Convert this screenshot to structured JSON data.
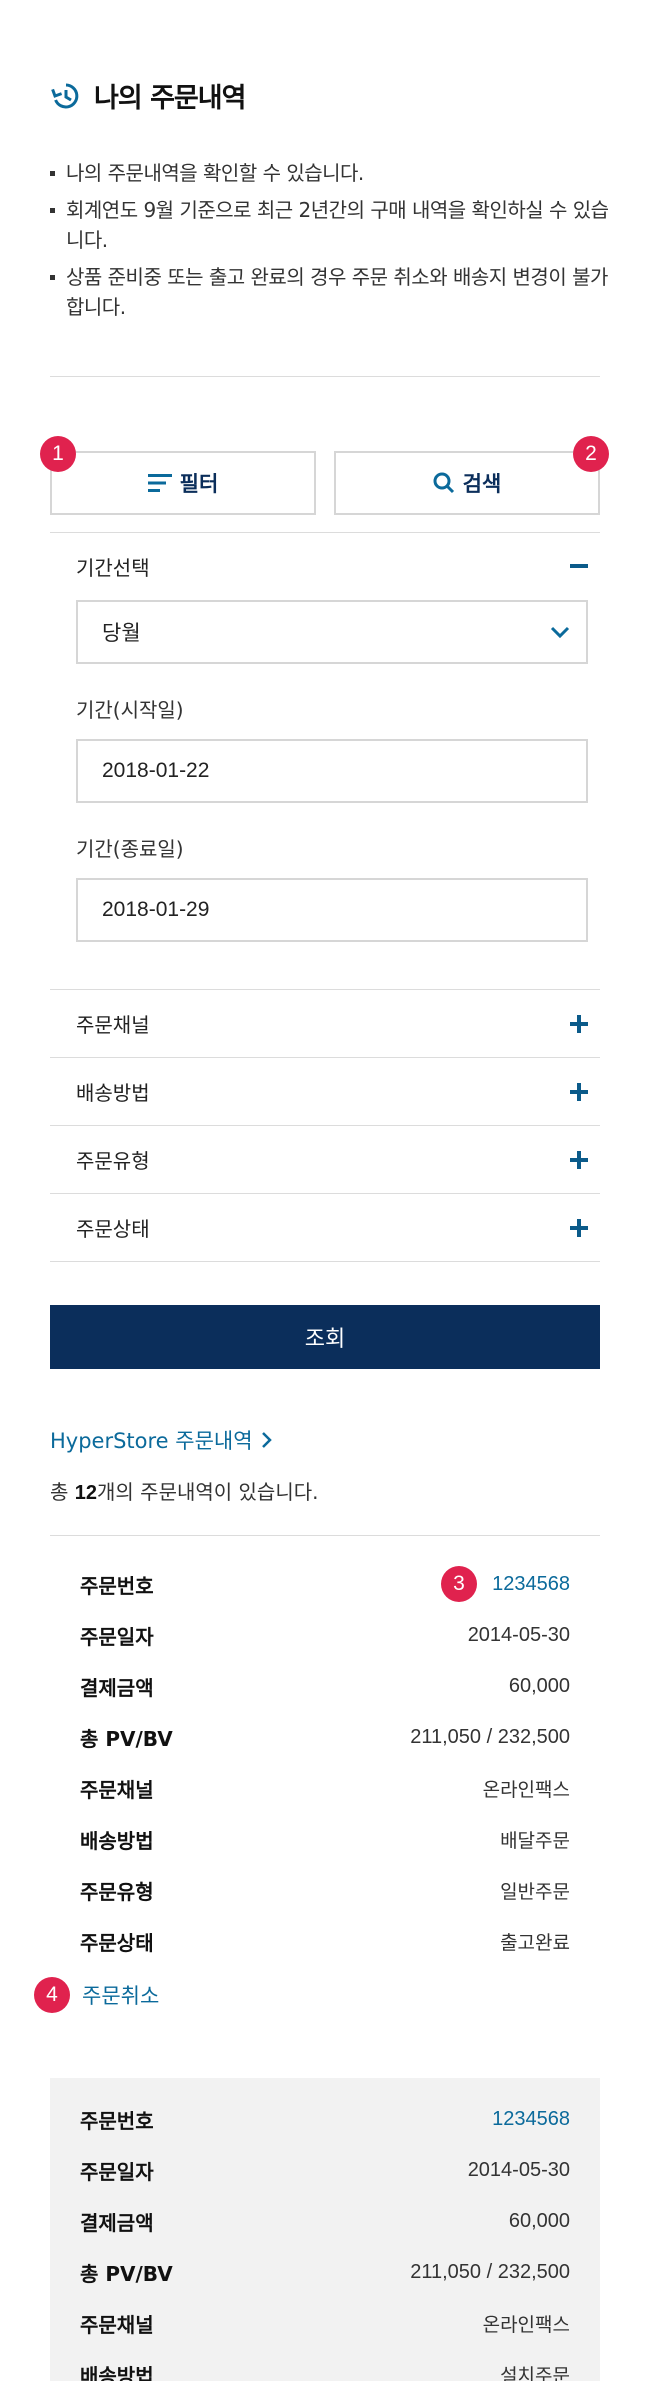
{
  "header": {
    "title": "나의 주문내역",
    "icon": "history-icon"
  },
  "notes": [
    "나의 주문내역을 확인할 수 있습니다.",
    "회계연도 9월 기준으로 최근 2년간의 구매 내역을 확인하실 수 있습니다.",
    "상품 준비중 또는 출고 완료의 경우 주문 취소와 배송지 변경이 불가합니다."
  ],
  "toolbar": {
    "filter_label": "필터",
    "search_label": "검색"
  },
  "badges": {
    "b1": "1",
    "b2": "2",
    "b3": "3",
    "b4": "4"
  },
  "filter": {
    "period_title": "기간선택",
    "period_value": "당월",
    "start_label": "기간(시작일)",
    "start_value": "2018-01-22",
    "end_label": "기간(종료일)",
    "end_value": "2018-01-29",
    "sections": [
      "주문채널",
      "배송방법",
      "주문유형",
      "주문상태"
    ]
  },
  "submit_label": "조회",
  "store": {
    "link_label": "HyperStore 주문내역",
    "total_prefix": "총 ",
    "total_count": "12",
    "total_suffix": "개의 주문내역이 있습니다."
  },
  "orders": [
    {
      "rows": [
        {
          "k": "주문번호",
          "v": "1234568"
        },
        {
          "k": "주문일자",
          "v": "2014-05-30"
        },
        {
          "k": "결제금액",
          "v": "60,000"
        },
        {
          "k": "총 PV/BV",
          "v": "211,050 / 232,500"
        },
        {
          "k": "주문채널",
          "v": "온라인팩스"
        },
        {
          "k": "배송방법",
          "v": "배달주문"
        },
        {
          "k": "주문유형",
          "v": "일반주문"
        },
        {
          "k": "주문상태",
          "v": "출고완료"
        }
      ],
      "cancel_label": "주문취소"
    },
    {
      "rows": [
        {
          "k": "주문번호",
          "v": "1234568"
        },
        {
          "k": "주문일자",
          "v": "2014-05-30"
        },
        {
          "k": "결제금액",
          "v": "60,000"
        },
        {
          "k": "총 PV/BV",
          "v": "211,050 / 232,500"
        },
        {
          "k": "주문채널",
          "v": "온라인팩스"
        },
        {
          "k": "배송방법",
          "v": "설치주문"
        }
      ]
    }
  ],
  "colors": {
    "accent": "#0b2e5b",
    "link": "#0b6a9b",
    "badge": "#e0224e"
  }
}
